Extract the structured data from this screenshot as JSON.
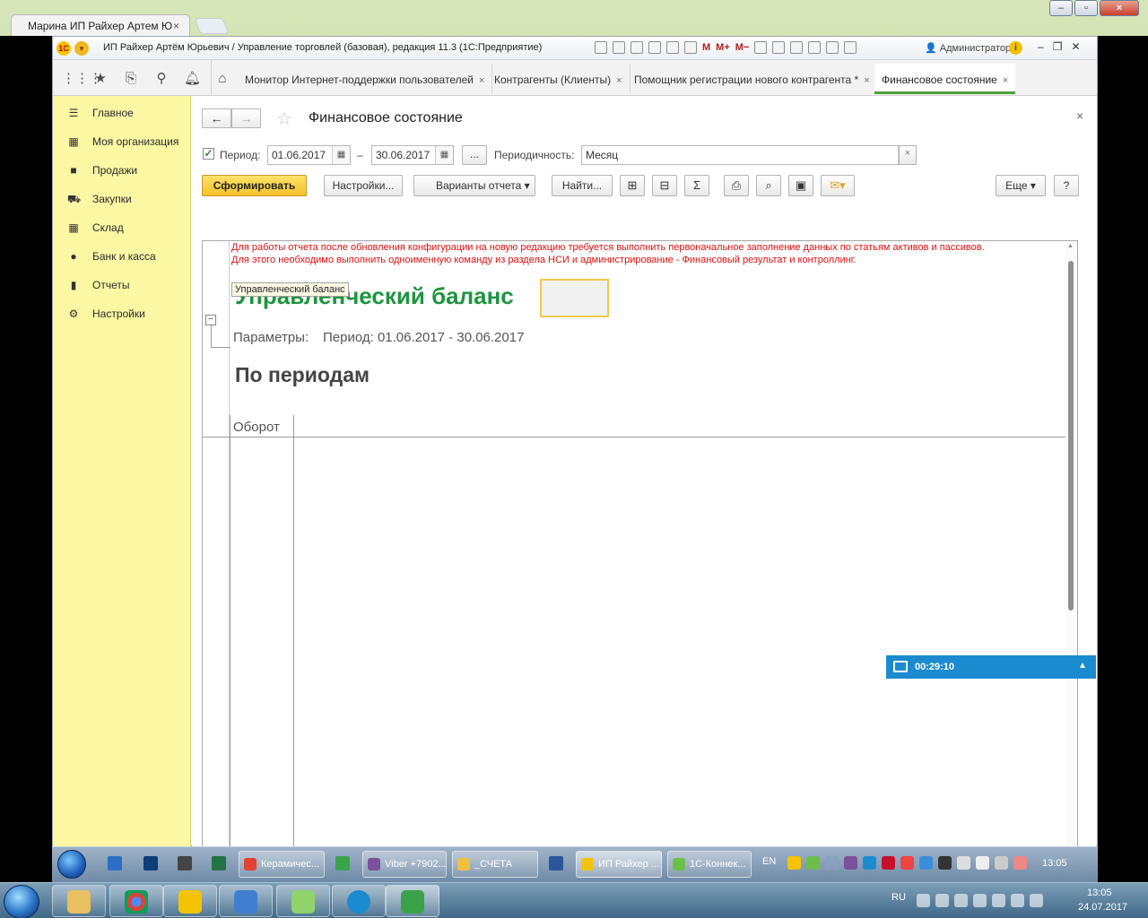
{
  "browser": {
    "tab_title": "Марина  ИП Райхер Артем Ю",
    "tab_close": "×"
  },
  "window1c": {
    "title": "ИП Райхер Артём Юрьевич / Управление торговлей (базовая), редакция 11.3  (1С:Предприятие)",
    "memory_buttons": [
      "M",
      "M+",
      "M−"
    ],
    "user": "Администратор",
    "info": "i"
  },
  "open_tabs": [
    {
      "label": "Монитор Интернет-поддержки пользователей",
      "close": "×"
    },
    {
      "label": "Контрагенты (Клиенты)",
      "close": "×"
    },
    {
      "label": "Помощник регистрации нового контрагента *",
      "close": "×"
    },
    {
      "label": "Финансовое состояние",
      "close": "×",
      "active": true
    }
  ],
  "sidebar": {
    "items": [
      {
        "label": "Главное",
        "icon": "menu-icon"
      },
      {
        "label": "Моя организация",
        "icon": "building-icon"
      },
      {
        "label": "Продажи",
        "icon": "bag-icon"
      },
      {
        "label": "Закупки",
        "icon": "cart-icon"
      },
      {
        "label": "Склад",
        "icon": "warehouse-icon"
      },
      {
        "label": "Банк и касса",
        "icon": "coin-icon"
      },
      {
        "label": "Отчеты",
        "icon": "bar-chart-icon"
      },
      {
        "label": "Настройки",
        "icon": "gear-icon"
      }
    ]
  },
  "form": {
    "title": "Финансовое состояние",
    "close": "×",
    "period_label": "Период:",
    "period_checked": true,
    "date_from": "01.06.2017",
    "date_separator": "–",
    "date_to": "30.06.2017",
    "dots": "...",
    "periodicity_label": "Периодичность:",
    "periodicity_value": "Месяц",
    "dropdown_arrow": "▾",
    "clear": "×"
  },
  "toolbar": {
    "generate": "Сформировать",
    "settings": "Настройки...",
    "variants": "Варианты отчета",
    "find": "Найти...",
    "sum": "Σ",
    "more": "Еще",
    "help": "?"
  },
  "report": {
    "warning_line1": "Для работы отчета после обновления конфигурации на новую редакцию требуется выполнить первоначальное заполнение данных по статьям активов и пассивов.",
    "warning_line2": "Для этого необходимо выполнить одноименную команду из раздела НСИ и администрирование - Финансовый результат и контроллинг.",
    "tooltip": "Управленческий баланс",
    "title": "Управленческий баланс",
    "params_label": "Параметры:",
    "params_value": "Период: 01.06.2017 - 30.06.2017",
    "section": "По периодам",
    "column": "Оборот",
    "collapse": "−"
  },
  "teamviewer": {
    "timer": "00:29:10",
    "arrow": "▲"
  },
  "remote_taskbar": {
    "tasks": [
      {
        "label": "Керамичес...",
        "color": "#e34234"
      },
      {
        "label": "Viber +7902...",
        "color": "#7b519d"
      },
      {
        "label": "_СЧЕТА",
        "color": "#f0c040"
      },
      {
        "label": "ИП Райхер ...",
        "color": "#f5c400"
      },
      {
        "label": "1С-Коннек...",
        "color": "#6cc04a"
      }
    ],
    "lang": "EN",
    "time": "13:05"
  },
  "taskbar": {
    "lang": "RU",
    "time": "13:05",
    "date": "24.07.2017"
  },
  "colors": {
    "accent_green": "#4da13a",
    "nav_yellow": "#fbf7a2",
    "warning_red": "#dd1111",
    "report_title_green": "#1e9440"
  }
}
